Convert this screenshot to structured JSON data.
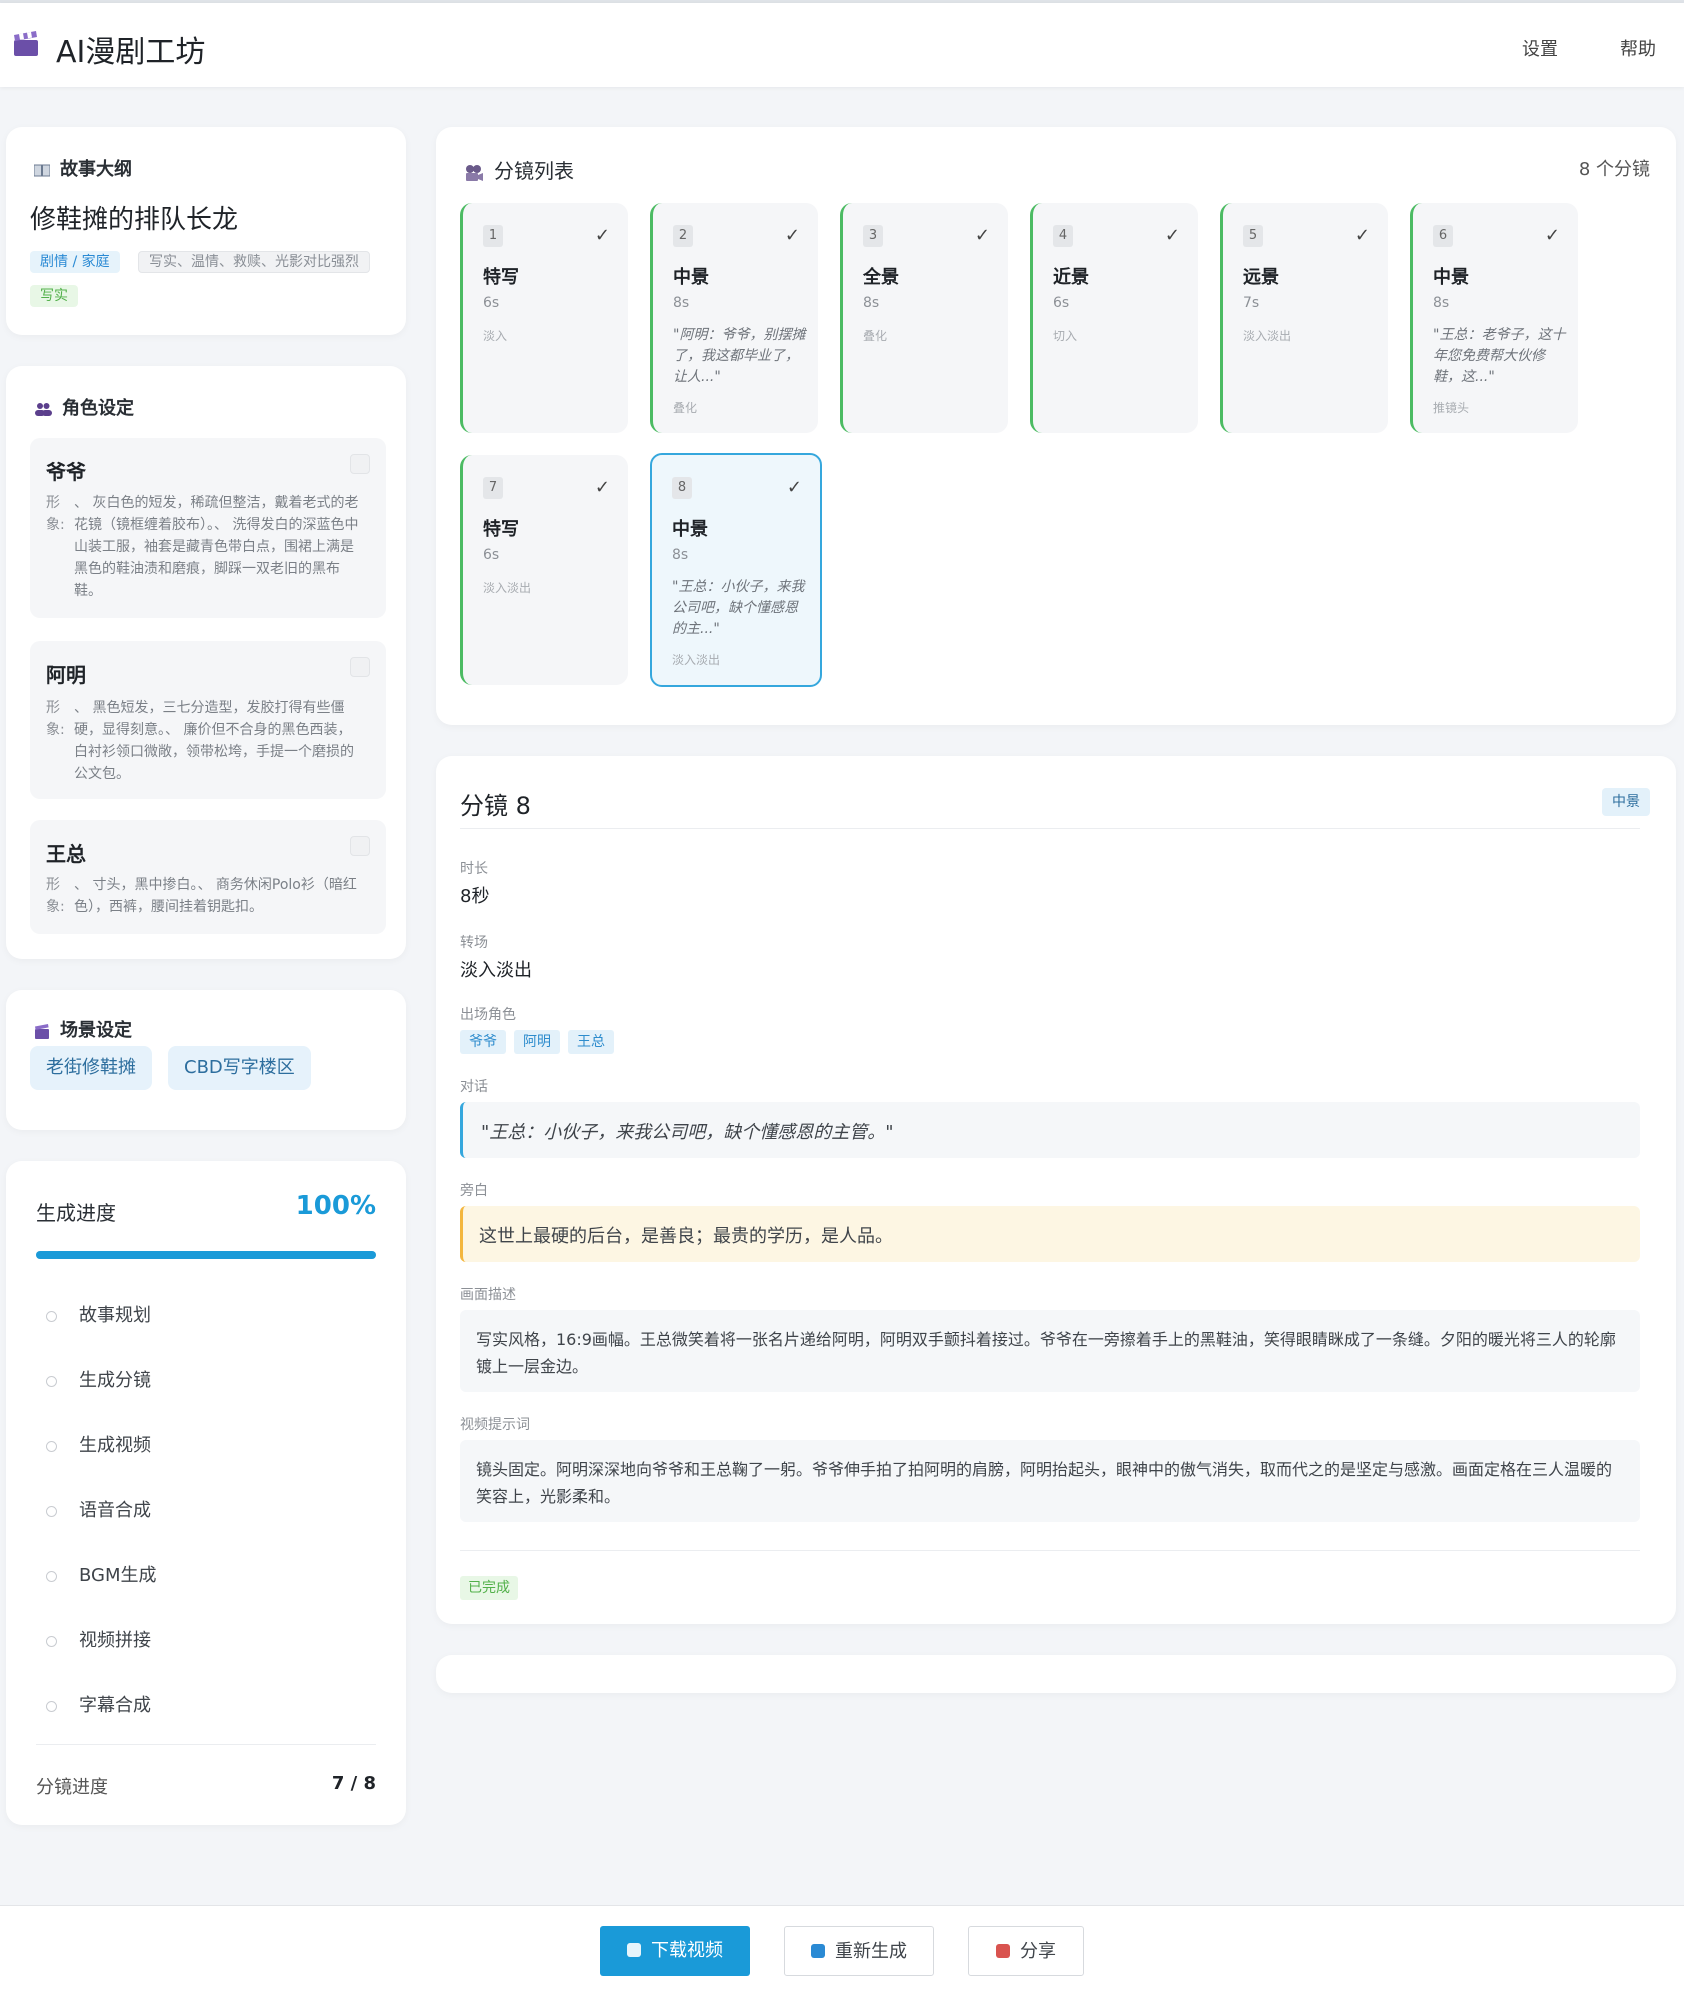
{
  "app": {
    "title": "AI漫剧工坊",
    "nav": [
      "设置",
      "帮助"
    ]
  },
  "story": {
    "section_title": "故事大纲",
    "name": "修鞋摊的排队长龙",
    "genre": "剧情 / 家庭",
    "style_tags": "写实、温情、救赎、光影对比强烈",
    "render_tag": "写实"
  },
  "characters": {
    "section_title": "角色设定",
    "label": "形象:",
    "items": [
      {
        "name": "爷爷",
        "desc": "、 灰白色的短发，稀疏但整洁，戴着老式的老花镜（镜框缠着胶布）。、 洗得发白的深蓝色中山装工服，袖套是藏青色带白点，围裙上满是黑色的鞋油渍和磨痕，脚踩一双老旧的黑布鞋。"
      },
      {
        "name": "阿明",
        "desc": "、 黑色短发，三七分造型，发胶打得有些僵硬，显得刻意。、 廉价但不合身的黑色西装，白衬衫领口微敞，领带松垮，手提一个磨损的公文包。"
      },
      {
        "name": "王总",
        "desc": "、 寸头，黑中掺白。、 商务休闲Polo衫（暗红色），西裤，腰间挂着钥匙扣。"
      }
    ]
  },
  "scenes": {
    "section_title": "场景设定",
    "items": [
      "老街修鞋摊",
      "CBD写字楼区"
    ]
  },
  "progress": {
    "title": "生成进度",
    "percent": "100%",
    "percent_value": 100,
    "steps": [
      "故事规划",
      "生成分镜",
      "生成视频",
      "语音合成",
      "BGM生成",
      "视频拼接",
      "字幕合成"
    ],
    "shot_progress_label": "分镜进度",
    "shot_progress_value": "7 / 8"
  },
  "storyboard": {
    "title": "分镜列表",
    "count": "8 个分镜",
    "check": "✓",
    "shots": [
      {
        "num": "1",
        "type": "特写",
        "dur": "6s",
        "dialogue": "",
        "transition": "淡入"
      },
      {
        "num": "2",
        "type": "中景",
        "dur": "8s",
        "dialogue": "\"阿明：爷爷，别摆摊了，我这都毕业了，让人...\"",
        "transition": "叠化"
      },
      {
        "num": "3",
        "type": "全景",
        "dur": "8s",
        "dialogue": "",
        "transition": "叠化"
      },
      {
        "num": "4",
        "type": "近景",
        "dur": "6s",
        "dialogue": "",
        "transition": "切入"
      },
      {
        "num": "5",
        "type": "远景",
        "dur": "7s",
        "dialogue": "",
        "transition": "淡入淡出"
      },
      {
        "num": "6",
        "type": "中景",
        "dur": "8s",
        "dialogue": "\"王总：老爷子，这十年您免费帮大伙修鞋，这...\"",
        "transition": "推镜头"
      },
      {
        "num": "7",
        "type": "特写",
        "dur": "6s",
        "dialogue": "",
        "transition": "淡入淡出"
      },
      {
        "num": "8",
        "type": "中景",
        "dur": "8s",
        "dialogue": "\"王总：小伙子，来我公司吧，缺个懂感恩的主...\"",
        "transition": "淡入淡出"
      }
    ]
  },
  "detail": {
    "title": "分镜 8",
    "shot_type": "中景",
    "duration_label": "时长",
    "duration": "8秒",
    "transition_label": "转场",
    "transition": "淡入淡出",
    "roles_label": "出场角色",
    "roles": [
      "爷爷",
      "阿明",
      "王总"
    ],
    "dialogue_label": "对话",
    "dialogue": "\"王总：小伙子，来我公司吧，缺个懂感恩的主管。\"",
    "narration_label": "旁白",
    "narration": "这世上最硬的后台，是善良；最贵的学历，是人品。",
    "visual_label": "画面描述",
    "visual": "写实风格，16:9画幅。王总微笑着将一张名片递给阿明，阿明双手颤抖着接过。爷爷在一旁擦着手上的黑鞋油，笑得眼睛眯成了一条缝。夕阳的暖光将三人的轮廓镀上一层金边。",
    "prompt_label": "视频提示词",
    "prompt": "镜头固定。阿明深深地向爷爷和王总鞠了一躬。爷爷伸手拍了拍阿明的肩膀，阿明抬起头，眼神中的傲气消失，取而代之的是坚定与感激。画面定格在三人温暖的笑容上，光影柔和。",
    "status": "已完成"
  },
  "footer": {
    "download": "下载视频",
    "regenerate": "重新生成",
    "share": "分享"
  },
  "colors": {
    "accent": "#1a9ad8",
    "done_green": "#4cbb63",
    "narration_bg": "#fdf6e3"
  }
}
